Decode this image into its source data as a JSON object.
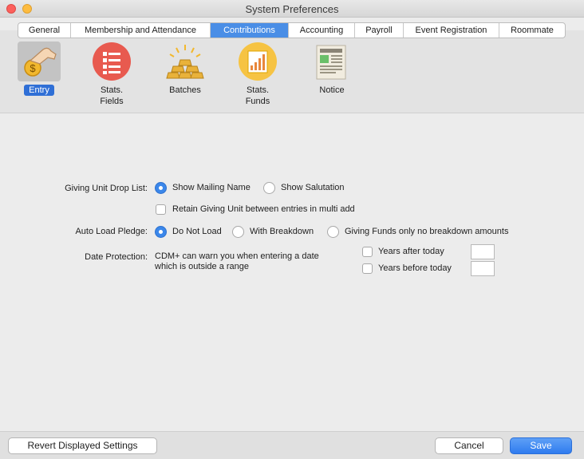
{
  "window": {
    "title": "System Preferences"
  },
  "tabs": [
    {
      "label": "General"
    },
    {
      "label": "Membership and Attendance"
    },
    {
      "label": "Contributions"
    },
    {
      "label": "Accounting"
    },
    {
      "label": "Payroll"
    },
    {
      "label": "Event Registration"
    },
    {
      "label": "Roommate"
    }
  ],
  "active_tab": "Contributions",
  "toolbar": {
    "items": [
      {
        "label": "Entry",
        "icon": "hand-coin-icon"
      },
      {
        "label": "Stats. Fields",
        "icon": "list-fields-icon"
      },
      {
        "label": "Batches",
        "icon": "gold-bars-icon"
      },
      {
        "label": "Stats. Funds",
        "icon": "bar-chart-icon"
      },
      {
        "label": "Notice",
        "icon": "newspaper-icon"
      }
    ],
    "selected": "Entry"
  },
  "form": {
    "giving_unit": {
      "label": "Giving Unit Drop List:",
      "options": [
        "Show Mailing Name",
        "Show Salutation"
      ],
      "selected": "Show Mailing Name",
      "retain_label": "Retain Giving Unit between entries in multi add",
      "retain_checked": false
    },
    "auto_load": {
      "label": "Auto Load Pledge:",
      "options": [
        "Do Not Load",
        "With Breakdown",
        "Giving Funds only no breakdown amounts"
      ],
      "selected": "Do Not Load"
    },
    "date_protection": {
      "label": "Date Protection:",
      "description_line1": "CDM+ can warn you when entering a date",
      "description_line2": "which is outside a range",
      "after_label": "Years after today",
      "before_label": "Years before today",
      "after_value": "",
      "before_value": ""
    }
  },
  "buttons": {
    "revert": "Revert Displayed Settings",
    "cancel": "Cancel",
    "save": "Save"
  },
  "colors": {
    "accent": "#3b87ea",
    "save": "#2f7bef"
  }
}
